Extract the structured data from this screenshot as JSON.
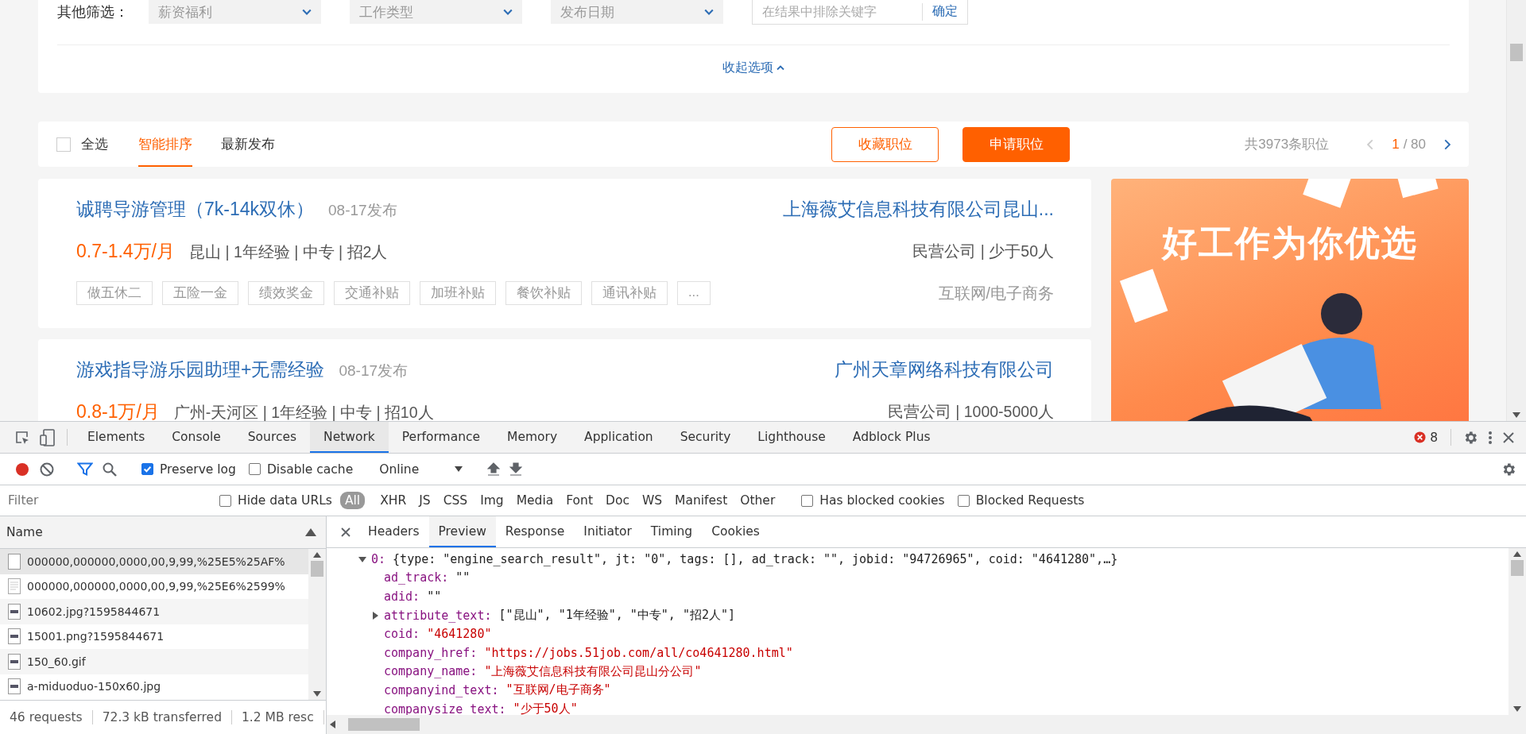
{
  "page": {
    "filters": {
      "label": "其他筛选：",
      "dropdowns": [
        "薪资福利",
        "工作类型",
        "发布日期"
      ],
      "exclude": {
        "placeholder": "在结果中排除关键字",
        "button": "确定"
      },
      "collapse": "收起选项"
    },
    "toolbar": {
      "select_all": {
        "label": "全选",
        "checked": false
      },
      "sort_tabs": [
        {
          "label": "智能排序",
          "selected": true
        },
        {
          "label": "最新发布",
          "selected": false
        }
      ],
      "buttons": [
        {
          "label": "收藏职位",
          "kind": "outline"
        },
        {
          "label": "申请职位",
          "kind": "primary"
        }
      ],
      "total": "共3973条职位",
      "pager": {
        "current": "1",
        "total": "/ 80"
      }
    },
    "jobs": [
      {
        "title": "诚聘导游管理（7k-14k双休）",
        "date": "08-17发布",
        "company": "上海薇艾信息科技有限公司昆山...",
        "salary": "0.7-1.4万/月",
        "info": "昆山 | 1年经验 | 中专 | 招2人",
        "company_info": "民营公司 | 少于50人",
        "tags": [
          "做五休二",
          "五险一金",
          "绩效奖金",
          "交通补贴",
          "加班补贴",
          "餐饮补贴",
          "通讯补贴",
          "..."
        ],
        "industry": "互联网/电子商务"
      },
      {
        "title": "游戏指导游乐园助理+无需经验",
        "date": "08-17发布",
        "company": "广州天章网络科技有限公司",
        "salary": "0.8-1万/月",
        "info": "广州-天河区 | 1年经验 | 中专 | 招10人",
        "company_info": "民营公司 | 1000-5000人"
      }
    ],
    "ad": {
      "headline": "好工作为你优选"
    }
  },
  "devtools": {
    "tabs": [
      {
        "label": "Elements",
        "selected": false
      },
      {
        "label": "Console",
        "selected": false
      },
      {
        "label": "Sources",
        "selected": false
      },
      {
        "label": "Network",
        "selected": true
      },
      {
        "label": "Performance",
        "selected": false
      },
      {
        "label": "Memory",
        "selected": false
      },
      {
        "label": "Application",
        "selected": false
      },
      {
        "label": "Security",
        "selected": false
      },
      {
        "label": "Lighthouse",
        "selected": false
      },
      {
        "label": "Adblock Plus",
        "selected": false
      }
    ],
    "error_count": "8",
    "toolbar": {
      "recording": true,
      "filter_active": true,
      "preserve_log": {
        "label": "Preserve log",
        "checked": true
      },
      "disable_cache": {
        "label": "Disable cache",
        "checked": false
      },
      "throttle": "Online"
    },
    "filter_bar": {
      "placeholder": "Filter",
      "hide_data_urls": {
        "label": "Hide data URLs",
        "checked": false
      },
      "types": [
        {
          "label": "All",
          "selected": true
        },
        {
          "label": "XHR",
          "selected": false
        },
        {
          "label": "JS",
          "selected": false
        },
        {
          "label": "CSS",
          "selected": false
        },
        {
          "label": "Img",
          "selected": false
        },
        {
          "label": "Media",
          "selected": false
        },
        {
          "label": "Font",
          "selected": false
        },
        {
          "label": "Doc",
          "selected": false
        },
        {
          "label": "WS",
          "selected": false
        },
        {
          "label": "Manifest",
          "selected": false
        },
        {
          "label": "Other",
          "selected": false
        }
      ],
      "options": [
        {
          "label": "Has blocked cookies",
          "checked": false
        },
        {
          "label": "Blocked Requests",
          "checked": false
        }
      ]
    },
    "requests": {
      "column": "Name",
      "rows": [
        {
          "name": "000000,000000,0000,00,9,99,%25E5%25AF%",
          "kind": "blank",
          "selected": true
        },
        {
          "name": "000000,000000,0000,00,9,99,%25E6%2599%",
          "kind": "document",
          "selected": false
        },
        {
          "name": "10602.jpg?1595844671",
          "kind": "image",
          "selected": false
        },
        {
          "name": "15001.png?1595844671",
          "kind": "image",
          "selected": false
        },
        {
          "name": "150_60.gif",
          "kind": "image",
          "selected": false
        },
        {
          "name": "a-miduoduo-150x60.jpg",
          "kind": "image",
          "selected": false
        }
      ]
    },
    "summary": [
      "46 requests",
      "72.3 kB transferred",
      "1.2 MB resc"
    ],
    "detail": {
      "tabs": [
        {
          "label": "Headers",
          "selected": false
        },
        {
          "label": "Preview",
          "selected": true
        },
        {
          "label": "Response",
          "selected": false
        },
        {
          "label": "Initiator",
          "selected": false
        },
        {
          "label": "Timing",
          "selected": false
        },
        {
          "label": "Cookies",
          "selected": false
        }
      ],
      "tree": [
        {
          "key": "0:",
          "summary": "{type: \"engine_search_result\", jt: \"0\", tags: [], ad_track: \"\", jobid: \"94726965\", coid: \"4641280\",…}",
          "expanded": true,
          "children": [
            {
              "key": "ad_track:",
              "value": "\"\"",
              "kind": "empty"
            },
            {
              "key": "adid:",
              "value": "\"\"",
              "kind": "empty"
            },
            {
              "key": "attribute_text:",
              "value": "[\"昆山\", \"1年经验\", \"中专\", \"招2人\"]",
              "kind": "array",
              "expanded": false
            },
            {
              "key": "coid:",
              "value": "\"4641280\"",
              "kind": "string"
            },
            {
              "key": "company_href:",
              "value": "\"https://jobs.51job.com/all/co4641280.html\"",
              "kind": "string"
            },
            {
              "key": "company_name:",
              "value": "\"上海薇艾信息科技有限公司昆山分公司\"",
              "kind": "string"
            },
            {
              "key": "companyind_text:",
              "value": "\"互联网/电子商务\"",
              "kind": "string"
            },
            {
              "key": "companysize_text:",
              "value": "\"少于50人\"",
              "kind": "string"
            }
          ]
        }
      ]
    }
  }
}
